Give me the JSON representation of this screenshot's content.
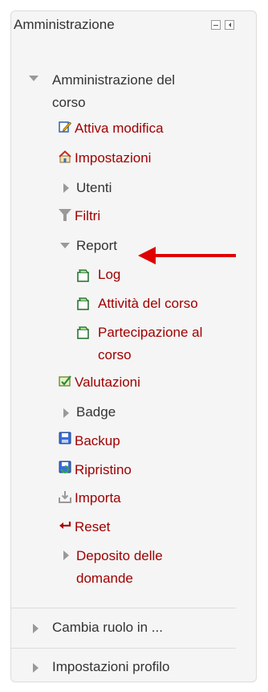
{
  "block": {
    "title": "Amministrazione",
    "hide_icon": "minus-box-icon",
    "dock_icon": "dock-left-icon"
  },
  "course_admin": {
    "label_line1": "Amministrazione del",
    "label_line2": "corso",
    "items": {
      "edit": "Attiva modifica",
      "settings": "Impostazioni",
      "users": "Utenti",
      "filters": "Filtri",
      "report": "Report",
      "log": "Log",
      "course_activity": "Attività del corso",
      "participation_line1": "Partecipazione al",
      "participation_line2": "corso",
      "grades": "Valutazioni",
      "badges": "Badge",
      "backup": "Backup",
      "restore": "Ripristino",
      "import": "Importa",
      "reset": "Reset",
      "question_bank_line1": "Deposito delle",
      "question_bank_line2": "domande"
    }
  },
  "switch_role": "Cambia ruolo in ...",
  "profile_settings": "Impostazioni profilo",
  "colors": {
    "link": "#a00000",
    "text": "#333333",
    "annotation_arrow": "#e00000",
    "block_background": "#f5f5f5"
  }
}
